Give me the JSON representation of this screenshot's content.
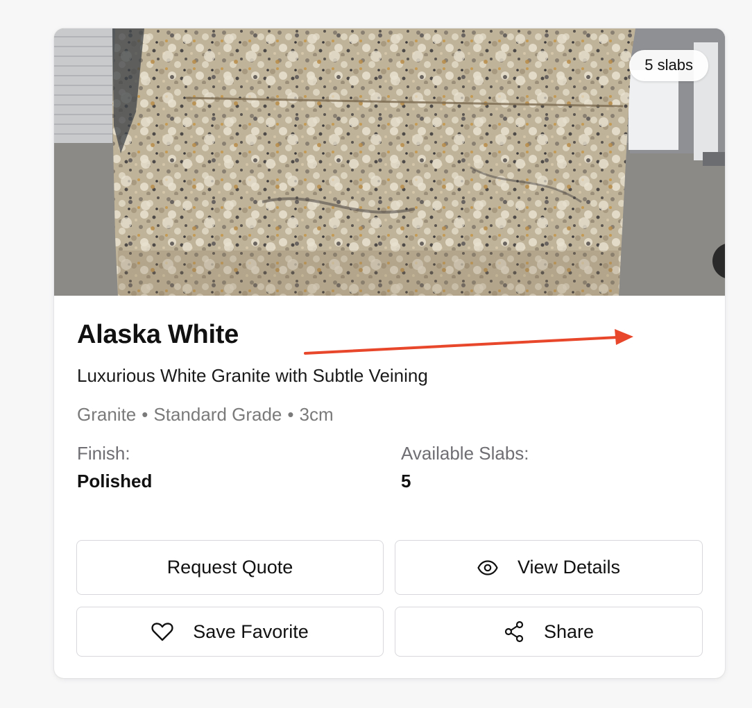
{
  "product": {
    "name": "Alaska White",
    "tagline": "Luxurious White Granite with Subtle Veining",
    "material": "Granite",
    "grade": "Standard Grade",
    "thickness": "3cm",
    "separator": "•",
    "slab_badge": "5 slabs"
  },
  "specs": {
    "finish_label": "Finish:",
    "finish_value": "Polished",
    "slabs_label": "Available Slabs:",
    "slabs_value": "5"
  },
  "actions": {
    "request_quote": "Request Quote",
    "view_details": "View Details",
    "save_favorite": "Save Favorite",
    "share": "Share"
  },
  "icons": {
    "view_details": "eye-icon",
    "save_favorite": "heart-icon",
    "share": "share-icon"
  },
  "colors": {
    "annotation_arrow": "#e8472b",
    "meta_text": "#7a7a7a",
    "button_border": "#d8d8dc"
  }
}
